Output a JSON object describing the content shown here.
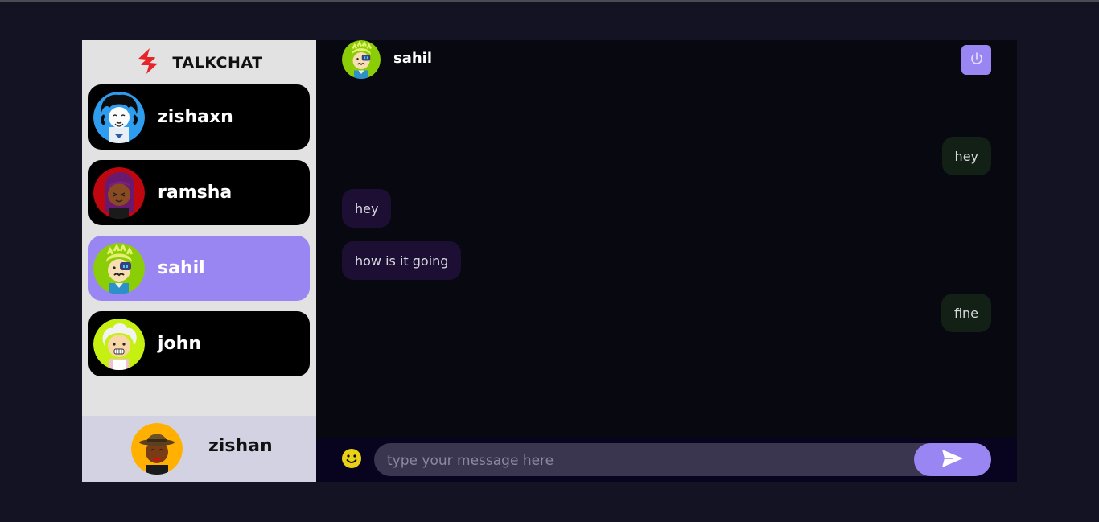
{
  "brand": {
    "name": "TALKCHAT",
    "logo_icon": "talkchat-logo-icon"
  },
  "contacts": [
    {
      "name": "zishaxn",
      "avatar_icon": "avatar-zishaxn-icon",
      "selected": false
    },
    {
      "name": "ramsha",
      "avatar_icon": "avatar-ramsha-icon",
      "selected": false
    },
    {
      "name": "sahil",
      "avatar_icon": "avatar-sahil-icon",
      "selected": true
    },
    {
      "name": "john",
      "avatar_icon": "avatar-john-icon",
      "selected": false
    }
  ],
  "current_user": {
    "name": "zishan",
    "avatar_icon": "avatar-zishan-icon"
  },
  "chat": {
    "contact_name": "sahil",
    "logout_icon": "power-icon",
    "messages": [
      {
        "text": "hey",
        "direction": "sent"
      },
      {
        "text": "hey",
        "direction": "received"
      },
      {
        "text": "how is it going",
        "direction": "received"
      },
      {
        "text": "fine",
        "direction": "sent"
      }
    ]
  },
  "composer": {
    "placeholder": "type your message here",
    "value": "",
    "emoji_icon": "emoji-icon",
    "send_icon": "send-icon"
  },
  "colors": {
    "page_bg": "#131324",
    "sidebar_bg": "#e2e2e2",
    "contact_bg": "#000000",
    "selected_contact_bg": "#9a86f3",
    "chat_bg": "#080811",
    "sent_bubble": "#132015",
    "received_bubble": "#1c0f33",
    "accent": "#9a86f3"
  }
}
